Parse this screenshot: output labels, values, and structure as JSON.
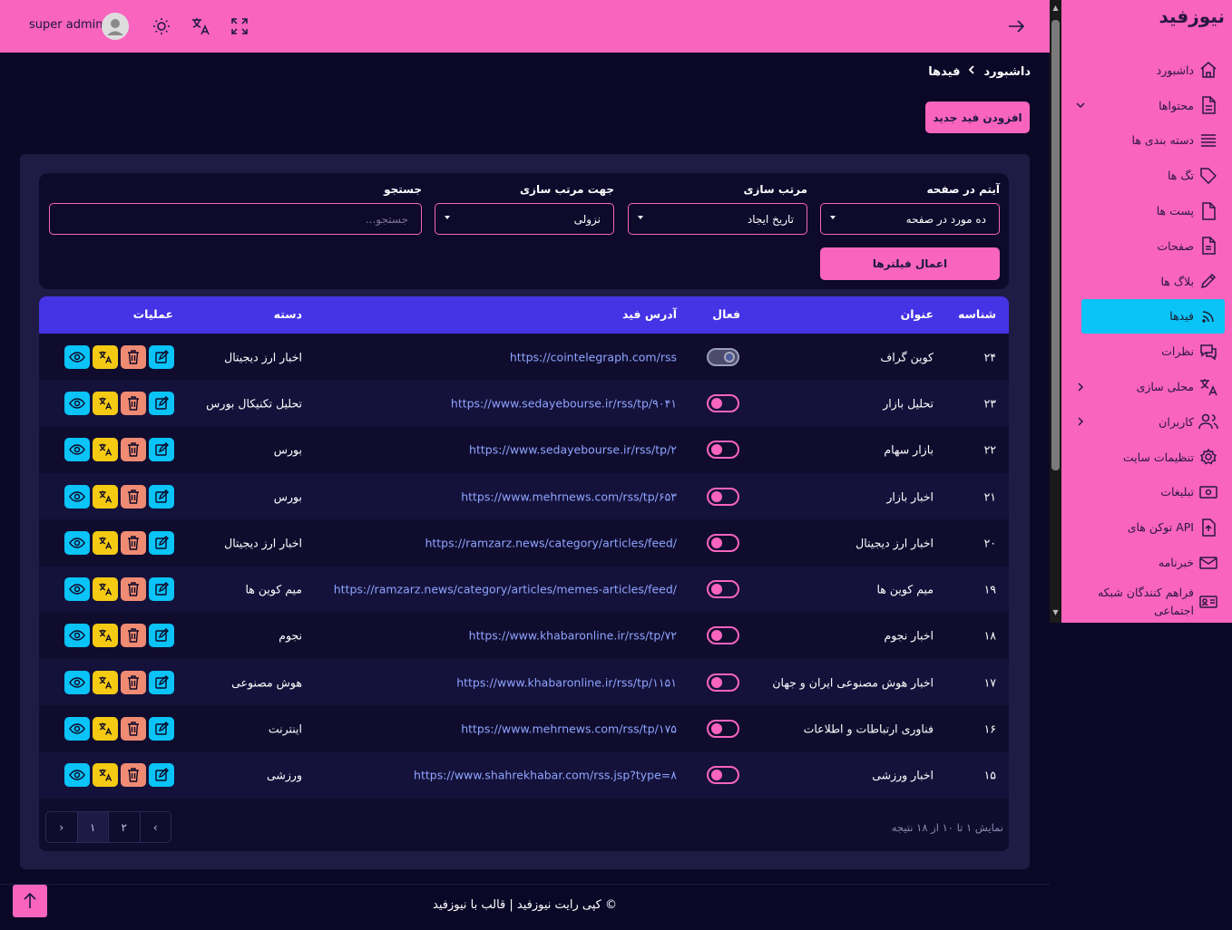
{
  "brand": "نیوزفید",
  "header": {
    "admin_name": "super admin"
  },
  "sidebar": {
    "items": [
      {
        "label": "داشبورد",
        "icon": "home-icon"
      },
      {
        "label": "محتواها",
        "icon": "file-icon",
        "chevron": "chevron-down"
      },
      {
        "label": "دسته بندی ها",
        "icon": "list-icon"
      },
      {
        "label": "تگ ها",
        "icon": "tag-icon"
      },
      {
        "label": "پست ها",
        "icon": "file-icon"
      },
      {
        "label": "صفحات",
        "icon": "document-icon"
      },
      {
        "label": "بلاگ ها",
        "icon": "pencil-icon"
      },
      {
        "label": "فیدها",
        "icon": "rss-icon",
        "active": true
      },
      {
        "label": "نظرات",
        "icon": "comments-icon"
      },
      {
        "label": "محلی سازی",
        "icon": "translate-icon",
        "chevron": "chevron-left"
      },
      {
        "label": "کاربران",
        "icon": "users-icon",
        "chevron": "chevron-left"
      },
      {
        "label": "تنظیمات سایت",
        "icon": "gear-icon"
      },
      {
        "label": "تبلیغات",
        "icon": "ad-icon"
      },
      {
        "label": "توکن های API",
        "icon": "key-file-icon"
      },
      {
        "label": "خبرنامه",
        "icon": "mail-icon"
      },
      {
        "label": "فراهم کنندگان شبکه اجتماعی",
        "icon": "id-card-icon"
      }
    ]
  },
  "breadcrumb": {
    "home": "داشبورد",
    "current": "فیدها"
  },
  "add_button": "افزودن فید جدید",
  "filters": {
    "per_page_label": "آیتم در صفحه",
    "per_page_value": "ده مورد در صفحه",
    "sort_label": "مرتب سازی",
    "sort_value": "تاریخ ایجاد",
    "order_label": "جهت مرتب سازی",
    "order_value": "نزولی",
    "search_label": "جستجو",
    "search_placeholder": "جستجو...",
    "apply": "اعمال فیلترها"
  },
  "table": {
    "headers": {
      "id": "شناسه",
      "title": "عنوان",
      "active": "فعال",
      "url": "آدرس فید",
      "category": "دسته",
      "actions": "عملیات"
    },
    "rows": [
      {
        "id": "۲۴",
        "title": "کوین گراف",
        "active": true,
        "url": "https://cointelegraph.com/rss",
        "category": "اخبار ارز دیجیتال"
      },
      {
        "id": "۲۳",
        "title": "تحلیل بازار",
        "active": false,
        "url": "https://www.sedayebourse.ir/rss/tp/۹۰۴۱",
        "category": "تحلیل تکنیکال بورس"
      },
      {
        "id": "۲۲",
        "title": "بازار سهام",
        "active": false,
        "url": "https://www.sedayebourse.ir/rss/tp/۲",
        "category": "بورس"
      },
      {
        "id": "۲۱",
        "title": "اخبار بازار",
        "active": false,
        "url": "https://www.mehrnews.com/rss/tp/۶۵۳",
        "category": "بورس"
      },
      {
        "id": "۲۰",
        "title": "اخبار ارز دیجیتال",
        "active": false,
        "url": "https://ramzarz.news/category/articles/feed/",
        "category": "اخبار ارز دیجیتال"
      },
      {
        "id": "۱۹",
        "title": "میم کوین ها",
        "active": false,
        "url": "https://ramzarz.news/category/articles/memes-articles/feed/",
        "category": "میم کوین ها"
      },
      {
        "id": "۱۸",
        "title": "اخبار نجوم",
        "active": false,
        "url": "https://www.khabaronline.ir/rss/tp/۷۲",
        "category": "نجوم"
      },
      {
        "id": "۱۷",
        "title": "اخبار هوش مصنوعی ایران و جهان",
        "active": false,
        "url": "https://www.khabaronline.ir/rss/tp/۱۱۵۱",
        "category": "هوش مصنوعی"
      },
      {
        "id": "۱۶",
        "title": "فناوری ارتباطات و اطلاعات",
        "active": false,
        "url": "https://www.mehrnews.com/rss/tp/۱۷۵",
        "category": "اینترنت"
      },
      {
        "id": "۱۵",
        "title": "اخبار ورزشی",
        "active": false,
        "url": "https://www.shahrekhabar.com/rss.jsp?type=۸",
        "category": "ورزشی"
      }
    ]
  },
  "pagination": {
    "prev": "‹",
    "pages": [
      "۲",
      "۱"
    ],
    "next": "›",
    "showing": "نمایش ۱ تا ۱۰ از ۱۸ نتیجه"
  },
  "footer": {
    "copyright": "© کپی رایت نیوزفید | قالب با نیوزفید"
  },
  "colors": {
    "accent": "#f964be",
    "active_nav": "#0ac3f7",
    "table_header": "#4534e5",
    "background": "#0b0827"
  }
}
